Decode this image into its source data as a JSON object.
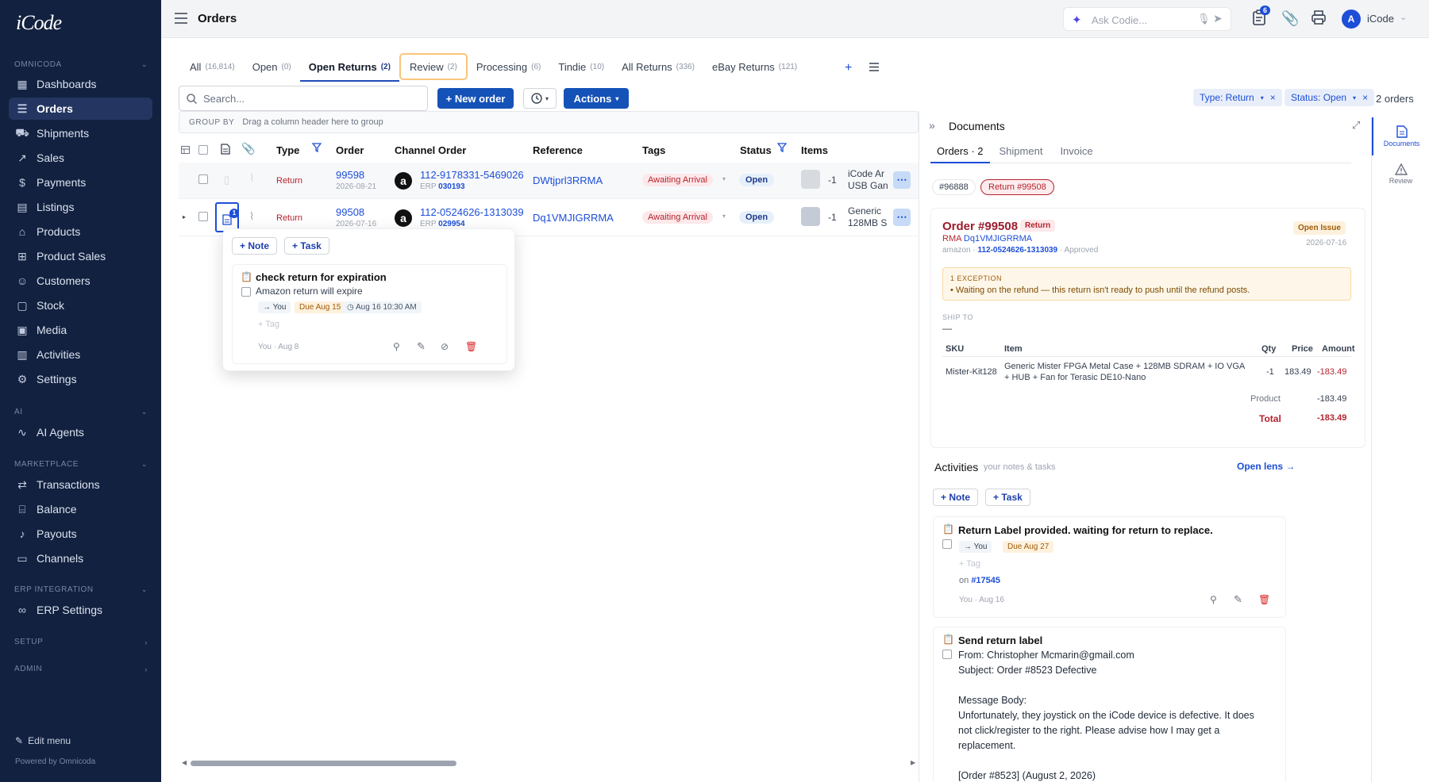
{
  "app": {
    "logo": "iCode"
  },
  "sidebar": {
    "sections": {
      "omnicoda": "OMNICODA",
      "ai": "AI",
      "marketplace": "MARKETPLACE",
      "erp": "ERP INTEGRATION",
      "setup": "SETUP",
      "admin": "ADMIN"
    },
    "items": [
      {
        "label": "Dashboards",
        "icon": "grid-icon"
      },
      {
        "label": "Orders",
        "icon": "list-icon",
        "active": true
      },
      {
        "label": "Shipments",
        "icon": "truck-icon"
      },
      {
        "label": "Sales",
        "icon": "trend-icon"
      },
      {
        "label": "Payments",
        "icon": "dollar-icon"
      },
      {
        "label": "Listings",
        "icon": "listings-icon"
      },
      {
        "label": "Products",
        "icon": "tag-icon"
      },
      {
        "label": "Product Sales",
        "icon": "cart-icon"
      },
      {
        "label": "Customers",
        "icon": "users-icon"
      },
      {
        "label": "Stock",
        "icon": "box-icon"
      },
      {
        "label": "Media",
        "icon": "image-icon"
      },
      {
        "label": "Activities",
        "icon": "clipboard-icon"
      },
      {
        "label": "Settings",
        "icon": "gear-icon"
      },
      {
        "label": "AI Agents",
        "icon": "pulse-icon"
      },
      {
        "label": "Transactions",
        "icon": "swap-icon"
      },
      {
        "label": "Balance",
        "icon": "building-icon"
      },
      {
        "label": "Payouts",
        "icon": "bell-icon"
      },
      {
        "label": "Channels",
        "icon": "channels-icon"
      },
      {
        "label": "ERP Settings",
        "icon": "link-icon"
      }
    ],
    "edit_menu": "Edit menu",
    "powered_by": "Powered by Omnicoda"
  },
  "topbar": {
    "title": "Orders",
    "ask_placeholder": "Ask Codie...",
    "notif_count": "6",
    "avatar_initial": "A",
    "user_name": "iCode"
  },
  "tabs": [
    {
      "label": "All",
      "count": "(16,814)"
    },
    {
      "label": "Open",
      "count": "(0)"
    },
    {
      "label": "Open Returns",
      "count": "(2)",
      "active": true
    },
    {
      "label": "Review",
      "count": "(2)"
    },
    {
      "label": "Processing",
      "count": "(6)"
    },
    {
      "label": "Tindie",
      "count": "(10)"
    },
    {
      "label": "All Returns",
      "count": "(336)"
    },
    {
      "label": "eBay Returns",
      "count": "(121)"
    }
  ],
  "toolbar": {
    "search_placeholder": "Search...",
    "new_order": "+ New order",
    "actions": "Actions",
    "filter_type": "Type: Return",
    "filter_status": "Status: Open",
    "order_count": "2 orders"
  },
  "grid": {
    "group_by_label": "GROUP BY",
    "group_by_hint": "Drag a column header here to group",
    "columns": {
      "type": "Type",
      "order": "Order",
      "channel_order": "Channel Order",
      "reference": "Reference",
      "tags": "Tags",
      "status": "Status",
      "items": "Items"
    },
    "rows": [
      {
        "type": "Return",
        "order": "99598",
        "date": "2026-08-21",
        "channel_order": "112-9178331-5469026",
        "erp_label": "ERP",
        "erp": "030193",
        "reference": "DWtjprl3RRMA",
        "tag": "Awaiting Arrival",
        "status": "Open",
        "qty": "-1",
        "item_l1": "iCode Ar",
        "item_l2": "USB Gan"
      },
      {
        "type": "Return",
        "order": "99508",
        "date": "2026-07-16",
        "channel_order": "112-0524626-1313039",
        "erp_label": "ERP",
        "erp": "029954",
        "reference": "Dq1VMJIGRRMA",
        "tag": "Awaiting Arrival",
        "status": "Open",
        "qty": "-1",
        "item_l1": "Generic",
        "item_l2": "128MB S",
        "note_badge": "1"
      }
    ]
  },
  "popup": {
    "note_btn": "+ Note",
    "task_btn": "+ Task",
    "task_title": "check return for expiration",
    "task_desc": "Amazon return will expire",
    "assignee": "→ You",
    "due": "Due Aug 15",
    "time": "Aug 16 10:30 AM",
    "tag_placeholder": "+ Tag",
    "meta": "You · Aug 8"
  },
  "documents": {
    "title": "Documents",
    "tabs": [
      "Orders · 2",
      "Shipment",
      "Invoice"
    ],
    "chips": [
      "#96888",
      "Return #99508"
    ],
    "order": {
      "title": "Order #99508",
      "badge": "Return",
      "issue": "Open Issue",
      "date": "2026-07-16",
      "rma_label": "RMA",
      "rma": "Dq1VMJIGRRMA",
      "channel": "amazon ·",
      "channel_order": "112-0524626-1313039",
      "approved": "· Approved"
    },
    "exception": {
      "label": "1 EXCEPTION",
      "text": "• Waiting on the refund — this return isn't ready to push until the refund posts."
    },
    "ship_to_label": "SHIP TO",
    "ship_to": "—",
    "table": {
      "headers": [
        "SKU",
        "Item",
        "Qty",
        "Price",
        "Amount"
      ],
      "sku": "Mister-Kit128",
      "item": "Generic Mister FPGA Metal Case + 128MB SDRAM + IO VGA + HUB + Fan for Terasic DE10-Nano",
      "qty": "-1",
      "price": "183.49",
      "amount": "-183.49"
    },
    "product_label": "Product",
    "product_value": "-183.49",
    "total_label": "Total",
    "total_value": "-183.49"
  },
  "activities": {
    "title": "Activities",
    "subtitle": "your notes & tasks",
    "open_lens": "Open lens →",
    "note_btn": "+ Note",
    "task_btn": "+ Task",
    "card1": {
      "title": "Return Label provided. waiting for return to replace.",
      "assignee": "→ You",
      "due": "Due Aug 27",
      "tag_placeholder": "+ Tag",
      "on_label": "on",
      "ref": "#17545",
      "meta": "You · Aug 16"
    },
    "card2": {
      "title": "Send return label",
      "line1": "From: Christopher Mcmarin@gmail.com",
      "line2": "Subject: Order #8523 Defective",
      "line3": "Message Body:",
      "line4": "Unfortunately, they joystick on the iCode device is defective. It does",
      "line5": "not click/register to the right. Please advise how I may get a",
      "line6": "replacement.",
      "line7": "[Order #8523] (August 2, 2026)"
    }
  },
  "rail": {
    "documents": "Documents",
    "review": "Review"
  }
}
